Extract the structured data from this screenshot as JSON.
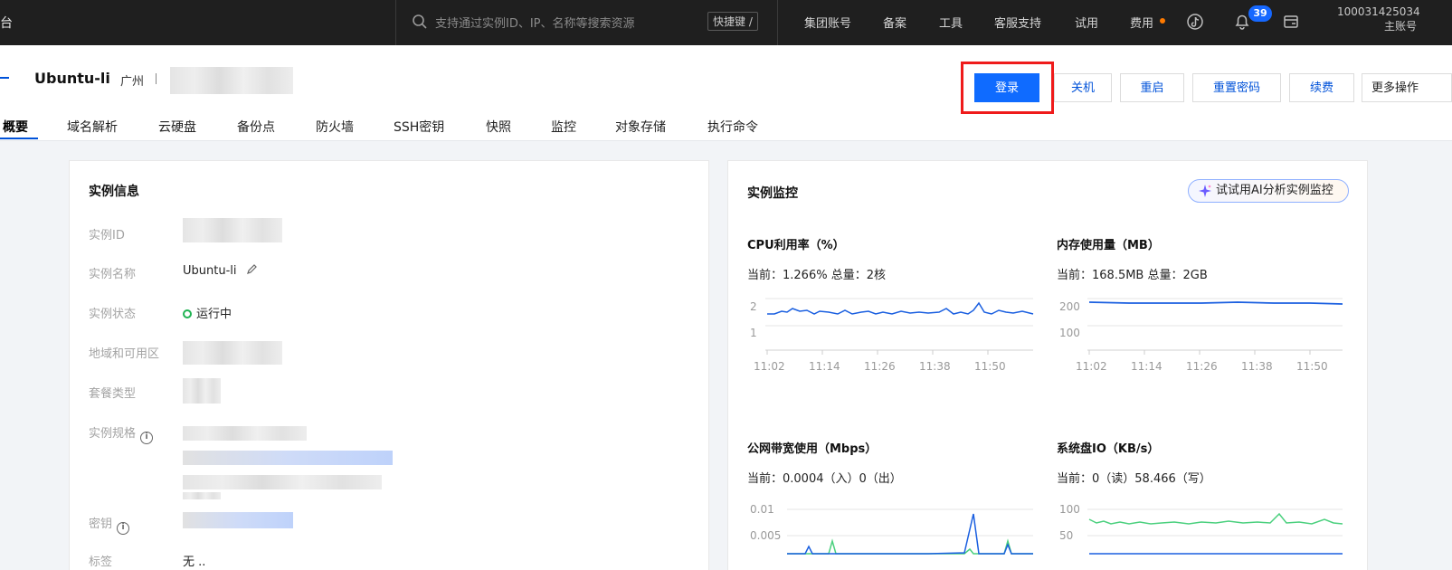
{
  "topbar": {
    "brand": "台",
    "search_placeholder": "支持通过实例ID、IP、名称等搜索资源",
    "shortcut": "快捷键 /",
    "nav": [
      "集团账号",
      "备案",
      "工具",
      "客服支持",
      "试用",
      "费用"
    ],
    "notification_count": "39",
    "account_id": "100031425034",
    "account_type": "主账号"
  },
  "header": {
    "instance_name": "Ubuntu-li",
    "region": "广州",
    "actions": {
      "login": "登录",
      "shutdown": "关机",
      "restart": "重启",
      "reset_password": "重置密码",
      "renew": "续费",
      "more": "更多操作"
    },
    "tabs": [
      "概要",
      "域名解析",
      "云硬盘",
      "备份点",
      "防火墙",
      "SSH密钥",
      "快照",
      "监控",
      "对象存储",
      "执行命令"
    ]
  },
  "instance_info": {
    "title": "实例信息",
    "labels": {
      "id": "实例ID",
      "name": "实例名称",
      "status": "实例状态",
      "zone": "地域和可用区",
      "plan": "套餐类型",
      "spec": "实例规格",
      "key": "密钥",
      "tags": "标签"
    },
    "values": {
      "name": "Ubuntu-li",
      "status": "运行中",
      "tags_partial": "无 .."
    }
  },
  "monitor": {
    "title": "实例监控",
    "ai_button": "试试用AI分析实例监控",
    "cpu": {
      "title": "CPU利用率（%）",
      "current": "当前：1.266% 总量：2核",
      "y_ticks": [
        "2",
        "1"
      ],
      "x_ticks": [
        "11:02",
        "11:14",
        "11:26",
        "11:38",
        "11:50"
      ]
    },
    "memory": {
      "title": "内存使用量（MB）",
      "current": "当前：168.5MB 总量：2GB",
      "y_ticks": [
        "200",
        "100"
      ],
      "x_ticks": [
        "11:02",
        "11:14",
        "11:26",
        "11:38",
        "11:50"
      ]
    },
    "bandwidth": {
      "title": "公网带宽使用（Mbps）",
      "current": "当前：0.0004（入）0（出）",
      "y_ticks": [
        "0.01",
        "0.005"
      ]
    },
    "disk_io": {
      "title": "系统盘IO（KB/s）",
      "current": "当前：0（读）58.466（写）",
      "y_ticks": [
        "100",
        "50"
      ]
    }
  },
  "colors": {
    "primary": "#0f6bff",
    "highlight": "#ef1b1b",
    "line_blue": "#1a5fe0",
    "line_green": "#4bd07e",
    "status_green": "#20b353"
  }
}
